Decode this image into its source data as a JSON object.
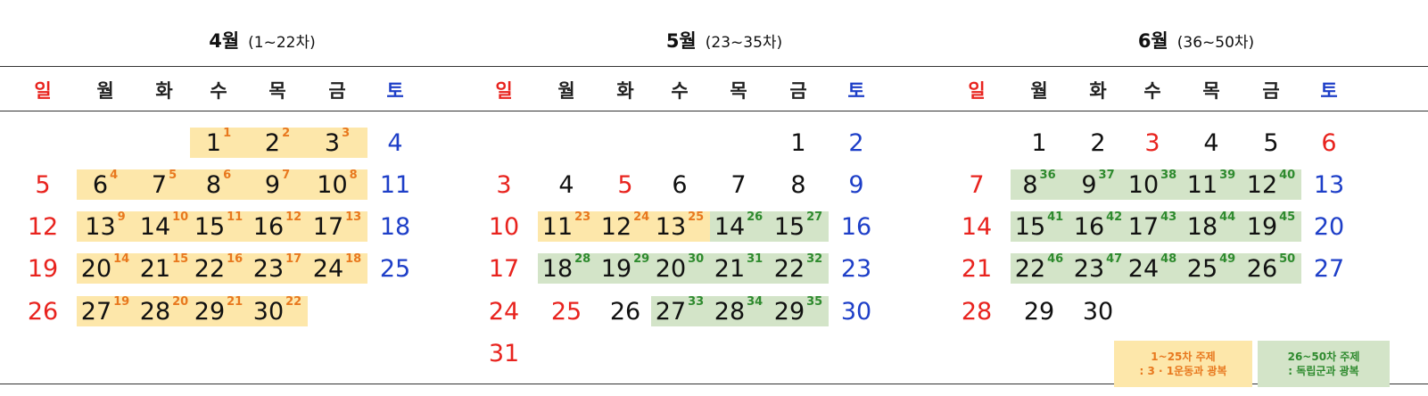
{
  "colors": {
    "sunday": "#e8231e",
    "saturday": "#1e3fc8",
    "weekday": "#111111",
    "header_weekday": "#222222",
    "yellow_bg": "#fde7aa",
    "yellow_sup": "#e8781e",
    "green_bg": "#d3e4c8",
    "green_sup": "#2e8a2e"
  },
  "weekdays": [
    "일",
    "월",
    "화",
    "수",
    "목",
    "금",
    "토"
  ],
  "months": [
    {
      "name": "4월",
      "range": "(1~22차)",
      "days": [
        {
          "d": "1",
          "s": "1",
          "t": "y",
          "c": 3,
          "r": 0
        },
        {
          "d": "2",
          "s": "2",
          "t": "y",
          "c": 4,
          "r": 0
        },
        {
          "d": "3",
          "s": "3",
          "t": "y",
          "c": 5,
          "r": 0
        },
        {
          "d": "4",
          "c": 6,
          "r": 0
        },
        {
          "d": "5",
          "c": 0,
          "r": 1
        },
        {
          "d": "6",
          "s": "4",
          "t": "y",
          "c": 1,
          "r": 1
        },
        {
          "d": "7",
          "s": "5",
          "t": "y",
          "c": 2,
          "r": 1
        },
        {
          "d": "8",
          "s": "6",
          "t": "y",
          "c": 3,
          "r": 1
        },
        {
          "d": "9",
          "s": "7",
          "t": "y",
          "c": 4,
          "r": 1
        },
        {
          "d": "10",
          "s": "8",
          "t": "y",
          "c": 5,
          "r": 1
        },
        {
          "d": "11",
          "c": 6,
          "r": 1
        },
        {
          "d": "12",
          "c": 0,
          "r": 2
        },
        {
          "d": "13",
          "s": "9",
          "t": "y",
          "c": 1,
          "r": 2
        },
        {
          "d": "14",
          "s": "10",
          "t": "y",
          "c": 2,
          "r": 2
        },
        {
          "d": "15",
          "s": "11",
          "t": "y",
          "c": 3,
          "r": 2
        },
        {
          "d": "16",
          "s": "12",
          "t": "y",
          "c": 4,
          "r": 2
        },
        {
          "d": "17",
          "s": "13",
          "t": "y",
          "c": 5,
          "r": 2
        },
        {
          "d": "18",
          "c": 6,
          "r": 2
        },
        {
          "d": "19",
          "c": 0,
          "r": 3
        },
        {
          "d": "20",
          "s": "14",
          "t": "y",
          "c": 1,
          "r": 3
        },
        {
          "d": "21",
          "s": "15",
          "t": "y",
          "c": 2,
          "r": 3
        },
        {
          "d": "22",
          "s": "16",
          "t": "y",
          "c": 3,
          "r": 3
        },
        {
          "d": "23",
          "s": "17",
          "t": "y",
          "c": 4,
          "r": 3
        },
        {
          "d": "24",
          "s": "18",
          "t": "y",
          "c": 5,
          "r": 3
        },
        {
          "d": "25",
          "c": 6,
          "r": 3
        },
        {
          "d": "26",
          "c": 0,
          "r": 4
        },
        {
          "d": "27",
          "s": "19",
          "t": "y",
          "c": 1,
          "r": 4
        },
        {
          "d": "28",
          "s": "20",
          "t": "y",
          "c": 2,
          "r": 4
        },
        {
          "d": "29",
          "s": "21",
          "t": "y",
          "c": 3,
          "r": 4
        },
        {
          "d": "30",
          "s": "22",
          "t": "y",
          "c": 4,
          "r": 4
        }
      ],
      "highlights": [
        {
          "t": "y",
          "r": 0,
          "c1": 3,
          "c2": 5
        },
        {
          "t": "y",
          "r": 1,
          "c1": 1,
          "c2": 5
        },
        {
          "t": "y",
          "r": 2,
          "c1": 1,
          "c2": 5
        },
        {
          "t": "y",
          "r": 3,
          "c1": 1,
          "c2": 5
        },
        {
          "t": "y",
          "r": 4,
          "c1": 1,
          "c2": 4
        }
      ]
    },
    {
      "name": "5월",
      "range": "(23~35차)",
      "days": [
        {
          "d": "1",
          "c": 5,
          "r": 0
        },
        {
          "d": "2",
          "c": 6,
          "r": 0
        },
        {
          "d": "3",
          "c": 0,
          "r": 1
        },
        {
          "d": "4",
          "c": 1,
          "r": 1
        },
        {
          "d": "5",
          "c": 2,
          "r": 1,
          "red": true
        },
        {
          "d": "6",
          "c": 3,
          "r": 1
        },
        {
          "d": "7",
          "c": 4,
          "r": 1
        },
        {
          "d": "8",
          "c": 5,
          "r": 1
        },
        {
          "d": "9",
          "c": 6,
          "r": 1
        },
        {
          "d": "10",
          "c": 0,
          "r": 2
        },
        {
          "d": "11",
          "s": "23",
          "t": "y",
          "c": 1,
          "r": 2
        },
        {
          "d": "12",
          "s": "24",
          "t": "y",
          "c": 2,
          "r": 2
        },
        {
          "d": "13",
          "s": "25",
          "t": "y",
          "c": 3,
          "r": 2
        },
        {
          "d": "14",
          "s": "26",
          "t": "g",
          "c": 4,
          "r": 2
        },
        {
          "d": "15",
          "s": "27",
          "t": "g",
          "c": 5,
          "r": 2
        },
        {
          "d": "16",
          "c": 6,
          "r": 2
        },
        {
          "d": "17",
          "c": 0,
          "r": 3
        },
        {
          "d": "18",
          "s": "28",
          "t": "g",
          "c": 1,
          "r": 3
        },
        {
          "d": "19",
          "s": "29",
          "t": "g",
          "c": 2,
          "r": 3
        },
        {
          "d": "20",
          "s": "30",
          "t": "g",
          "c": 3,
          "r": 3
        },
        {
          "d": "21",
          "s": "31",
          "t": "g",
          "c": 4,
          "r": 3
        },
        {
          "d": "22",
          "s": "32",
          "t": "g",
          "c": 5,
          "r": 3
        },
        {
          "d": "23",
          "c": 6,
          "r": 3
        },
        {
          "d": "24",
          "c": 0,
          "r": 4
        },
        {
          "d": "25",
          "c": 1,
          "r": 4,
          "red": true
        },
        {
          "d": "26",
          "c": 2,
          "r": 4
        },
        {
          "d": "27",
          "s": "33",
          "t": "g",
          "c": 3,
          "r": 4
        },
        {
          "d": "28",
          "s": "34",
          "t": "g",
          "c": 4,
          "r": 4
        },
        {
          "d": "29",
          "s": "35",
          "t": "g",
          "c": 5,
          "r": 4
        },
        {
          "d": "30",
          "c": 6,
          "r": 4
        },
        {
          "d": "31",
          "c": 0,
          "r": 5
        }
      ],
      "highlights": [
        {
          "t": "y",
          "r": 2,
          "c1": 1,
          "c2": 3
        },
        {
          "t": "g",
          "r": 2,
          "c1": 4,
          "c2": 5
        },
        {
          "t": "g",
          "r": 3,
          "c1": 1,
          "c2": 5
        },
        {
          "t": "g",
          "r": 4,
          "c1": 3,
          "c2": 5
        }
      ]
    },
    {
      "name": "6월",
      "range": "(36~50차)",
      "days": [
        {
          "d": "1",
          "c": 1,
          "r": 0
        },
        {
          "d": "2",
          "c": 2,
          "r": 0
        },
        {
          "d": "3",
          "c": 3,
          "r": 0,
          "red": true
        },
        {
          "d": "4",
          "c": 4,
          "r": 0
        },
        {
          "d": "5",
          "c": 5,
          "r": 0
        },
        {
          "d": "6",
          "c": 6,
          "r": 0,
          "red": true
        },
        {
          "d": "7",
          "c": 0,
          "r": 1
        },
        {
          "d": "8",
          "s": "36",
          "t": "g",
          "c": 1,
          "r": 1
        },
        {
          "d": "9",
          "s": "37",
          "t": "g",
          "c": 2,
          "r": 1
        },
        {
          "d": "10",
          "s": "38",
          "t": "g",
          "c": 3,
          "r": 1
        },
        {
          "d": "11",
          "s": "39",
          "t": "g",
          "c": 4,
          "r": 1
        },
        {
          "d": "12",
          "s": "40",
          "t": "g",
          "c": 5,
          "r": 1
        },
        {
          "d": "13",
          "c": 6,
          "r": 1
        },
        {
          "d": "14",
          "c": 0,
          "r": 2
        },
        {
          "d": "15",
          "s": "41",
          "t": "g",
          "c": 1,
          "r": 2
        },
        {
          "d": "16",
          "s": "42",
          "t": "g",
          "c": 2,
          "r": 2
        },
        {
          "d": "17",
          "s": "43",
          "t": "g",
          "c": 3,
          "r": 2
        },
        {
          "d": "18",
          "s": "44",
          "t": "g",
          "c": 4,
          "r": 2
        },
        {
          "d": "19",
          "s": "45",
          "t": "g",
          "c": 5,
          "r": 2
        },
        {
          "d": "20",
          "c": 6,
          "r": 2
        },
        {
          "d": "21",
          "c": 0,
          "r": 3
        },
        {
          "d": "22",
          "s": "46",
          "t": "g",
          "c": 1,
          "r": 3
        },
        {
          "d": "23",
          "s": "47",
          "t": "g",
          "c": 2,
          "r": 3
        },
        {
          "d": "24",
          "s": "48",
          "t": "g",
          "c": 3,
          "r": 3
        },
        {
          "d": "25",
          "s": "49",
          "t": "g",
          "c": 4,
          "r": 3
        },
        {
          "d": "26",
          "s": "50",
          "t": "g",
          "c": 5,
          "r": 3
        },
        {
          "d": "27",
          "c": 6,
          "r": 3
        },
        {
          "d": "28",
          "c": 0,
          "r": 4
        },
        {
          "d": "29",
          "c": 1,
          "r": 4
        },
        {
          "d": "30",
          "c": 2,
          "r": 4
        }
      ],
      "highlights": [
        {
          "t": "g",
          "r": 1,
          "c1": 1,
          "c2": 5
        },
        {
          "t": "g",
          "r": 2,
          "c1": 1,
          "c2": 5
        },
        {
          "t": "g",
          "r": 3,
          "c1": 1,
          "c2": 5
        }
      ]
    }
  ],
  "legend": {
    "yellow": {
      "line1": "1~25차 주제",
      "line2": ": 3 · 1운동과 광복"
    },
    "green": {
      "line1": "26~50차 주제",
      "line2": ": 독립군과 광복"
    }
  }
}
